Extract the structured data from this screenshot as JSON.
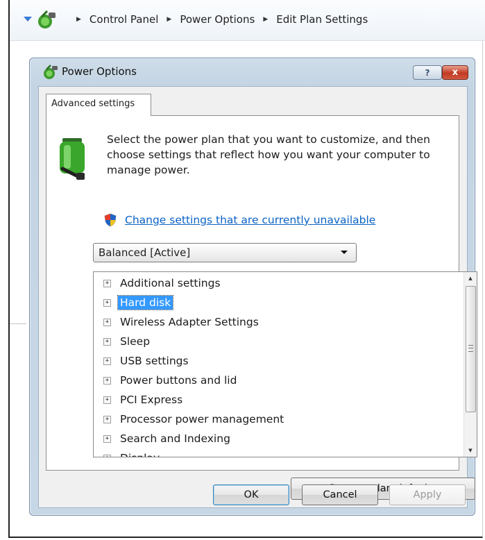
{
  "address_bar": {
    "breadcrumbs": [
      "Control Panel",
      "Power Options",
      "Edit Plan Settings"
    ]
  },
  "dialog": {
    "title": "Power Options",
    "help_label": "?",
    "close_label": "x",
    "tab_label": "Advanced settings",
    "description": "Select the power plan that you want to customize, and then choose settings that reflect how you want your computer to manage power.",
    "change_link": "Change settings that are currently unavailable",
    "plan_select_value": "Balanced [Active]",
    "tree_items": [
      {
        "label": "Additional settings",
        "selected": false
      },
      {
        "label": "Hard disk",
        "selected": true
      },
      {
        "label": "Wireless Adapter Settings",
        "selected": false
      },
      {
        "label": "Sleep",
        "selected": false
      },
      {
        "label": "USB settings",
        "selected": false
      },
      {
        "label": "Power buttons and lid",
        "selected": false
      },
      {
        "label": "PCI Express",
        "selected": false
      },
      {
        "label": "Processor power management",
        "selected": false
      },
      {
        "label": "Search and Indexing",
        "selected": false
      },
      {
        "label": "Display",
        "selected": false
      }
    ],
    "restore_button": "Restore plan defaults",
    "ok_button": "OK",
    "cancel_button": "Cancel",
    "apply_button": "Apply"
  },
  "icons": {
    "address_icon": "power-options-icon",
    "battery": "battery-plug-icon",
    "shield": "uac-shield-icon"
  },
  "colors": {
    "link": "#0b63c5",
    "selection": "#3399ff",
    "close": "#c13a22"
  }
}
